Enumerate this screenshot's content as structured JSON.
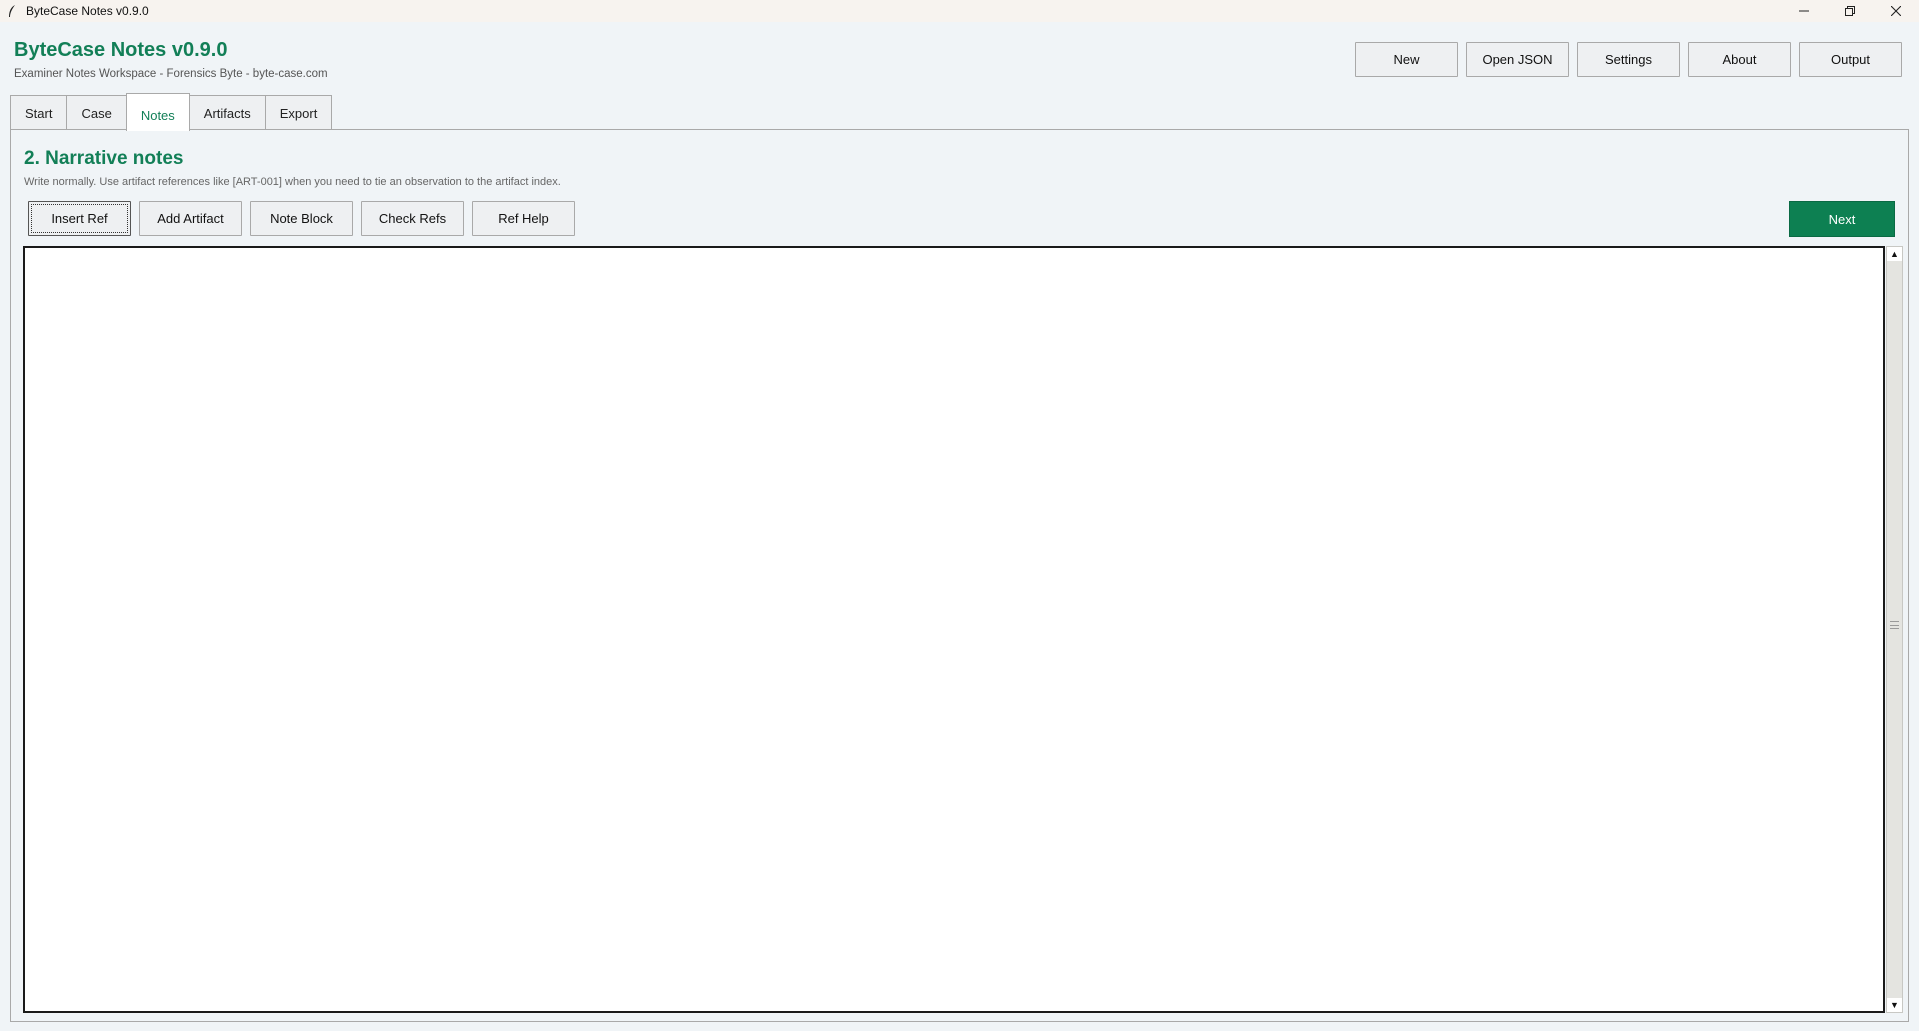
{
  "window": {
    "title": "ByteCase Notes v0.9.0",
    "icon": "feather-icon",
    "controls": {
      "minimize": "minimize-icon",
      "maximize": "restore-icon",
      "close": "close-icon"
    }
  },
  "header": {
    "title": "ByteCase Notes v0.9.0",
    "subtitle": "Examiner Notes Workspace - Forensics Byte - byte-case.com",
    "buttons": {
      "new": "New",
      "open_json": "Open JSON",
      "settings": "Settings",
      "about": "About",
      "output": "Output"
    }
  },
  "tabs": {
    "start": "Start",
    "case": "Case",
    "notes": "Notes",
    "artifacts": "Artifacts",
    "export": "Export",
    "active": "Notes"
  },
  "notes_panel": {
    "title": "2. Narrative notes",
    "hint": "Write normally. Use artifact references like [ART-001] when you need to tie an observation to the artifact index.",
    "toolbar": {
      "insert_ref": "Insert Ref",
      "add_artifact": "Add Artifact",
      "note_block": "Note Block",
      "check_refs": "Check Refs",
      "ref_help": "Ref Help"
    },
    "next": "Next",
    "editor_value": ""
  },
  "colors": {
    "accent": "#127f57",
    "next_button": "#0d8052",
    "background": "#f0f4f7"
  }
}
